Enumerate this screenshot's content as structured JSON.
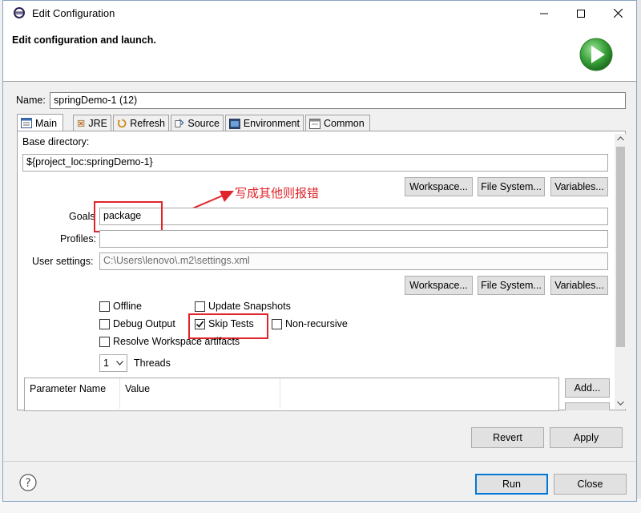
{
  "window": {
    "title": "Edit Configuration"
  },
  "header": {
    "title": "Edit configuration and launch."
  },
  "name_field": {
    "label": "Name:",
    "value": "springDemo-1 (12)"
  },
  "tabs": [
    {
      "label": "Main",
      "icon": "main-tab-icon"
    },
    {
      "label": "JRE",
      "icon": "jre-icon"
    },
    {
      "label": "Refresh",
      "icon": "refresh-icon"
    },
    {
      "label": "Source",
      "icon": "source-icon"
    },
    {
      "label": "Environment",
      "icon": "environment-icon"
    },
    {
      "label": "Common",
      "icon": "common-icon"
    }
  ],
  "main": {
    "base_dir_label": "Base directory:",
    "base_dir_value": "${project_loc:springDemo-1}",
    "workspace_btn": "Workspace...",
    "filesystem_btn": "File System...",
    "variables_btn": "Variables...",
    "goals_label": "Goals",
    "goals_value": "package",
    "annotation": "写成其他则报错",
    "profiles_label": "Profiles:",
    "profiles_value": "",
    "user_settings_label": "User settings:",
    "user_settings_value": "C:\\Users\\lenovo\\.m2\\settings.xml",
    "options": {
      "offline": "Offline",
      "update_snapshots": "Update Snapshots",
      "debug_output": "Debug Output",
      "skip_tests": "Skip Tests",
      "non_recursive": "Non-recursive",
      "resolve_workspace": "Resolve Workspace artifacts"
    },
    "threads_value": "1",
    "threads_label": "Threads",
    "table_headers": [
      "Parameter Name",
      "Value"
    ],
    "add_btn": "Add..."
  },
  "actions": {
    "revert": "Revert",
    "apply": "Apply",
    "run": "Run",
    "close": "Close"
  },
  "colors": {
    "accent": "#0078d7",
    "annotation_red": "#e0242a",
    "run_green": "#3aa33a"
  }
}
